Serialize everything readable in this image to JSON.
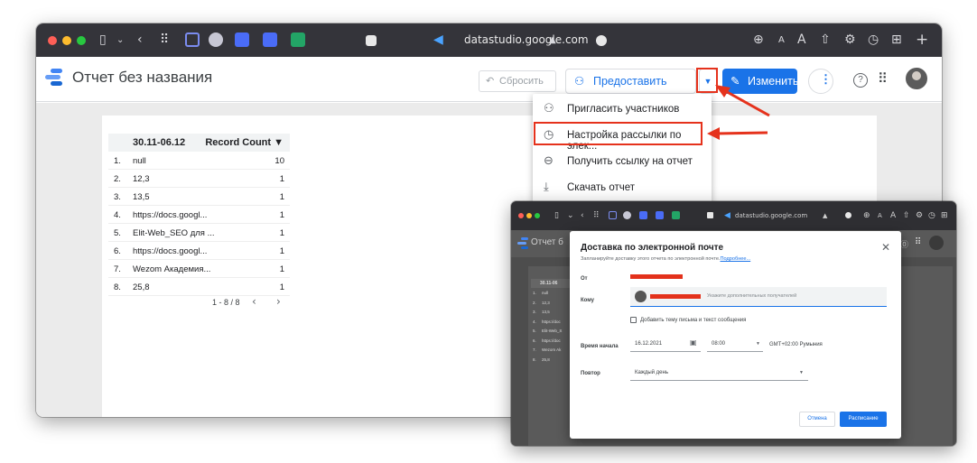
{
  "browser": {
    "url": "datastudio.google.com",
    "traffic_lights": [
      "#ff5f57",
      "#febc2e",
      "#28c840"
    ]
  },
  "app": {
    "title": "Отчет без названия",
    "reset_label": "Сбросить",
    "share_label": "Предоставить доступ",
    "edit_label": "Изменить",
    "help_icon": "?",
    "brand_colors": {
      "primary": "#1a73e8",
      "annotation": "#e5321c"
    }
  },
  "table": {
    "col1_header": "30.11-06.12",
    "col2_header": "Record Count ▼",
    "rows": [
      {
        "n": "1.",
        "label": "null",
        "value": "10"
      },
      {
        "n": "2.",
        "label": "12,3",
        "value": "1"
      },
      {
        "n": "3.",
        "label": "13,5",
        "value": "1"
      },
      {
        "n": "4.",
        "label": "https://docs.googl...",
        "value": "1"
      },
      {
        "n": "5.",
        "label": "Elit-Web_SEO для ...",
        "value": "1"
      },
      {
        "n": "6.",
        "label": "https://docs.googl...",
        "value": "1"
      },
      {
        "n": "7.",
        "label": "Wezom Академия...",
        "value": "1"
      },
      {
        "n": "8.",
        "label": "25,8",
        "value": "1"
      }
    ],
    "pagination": "1 - 8 / 8"
  },
  "menu": {
    "items": [
      {
        "icon": "add-person-icon",
        "label": "Пригласить участников"
      },
      {
        "icon": "clock-icon",
        "label": "Настройка рассылки по элек..."
      },
      {
        "icon": "link-icon",
        "label": "Получить ссылку на отчет"
      },
      {
        "icon": "download-icon",
        "label": "Скачать отчет"
      }
    ]
  },
  "dialog": {
    "title": "Доставка по электронной почте",
    "subtitle": "Запланируйте доставку этого отчета по электронной почте.",
    "learn_more": "Подробнее...",
    "from_label": "От",
    "to_label": "Кому",
    "recipients_placeholder": "Укажите дополнительных получателей",
    "add_subject_label": "Добавить тему письма и текст сообщения",
    "start_label": "Время начала",
    "start_date": "16.12.2021",
    "start_time": "08:00",
    "timezone": "GMT+02:00 Румыния",
    "repeat_label": "Повтор",
    "repeat_value": "Каждый день",
    "cancel_label": "Отмена",
    "schedule_label": "Расписание"
  },
  "mini_window": {
    "title_fragment": "Отчет б",
    "col_header": "30.11-06",
    "rows": [
      {
        "n": "1.",
        "label": "null"
      },
      {
        "n": "2.",
        "label": "12,3"
      },
      {
        "n": "3.",
        "label": "13,5"
      },
      {
        "n": "4.",
        "label": "https://doc"
      },
      {
        "n": "5.",
        "label": "Elit-Web_S"
      },
      {
        "n": "6.",
        "label": "https://doc"
      },
      {
        "n": "7.",
        "label": "Wezom Ak"
      },
      {
        "n": "8.",
        "label": "25,8"
      }
    ]
  }
}
